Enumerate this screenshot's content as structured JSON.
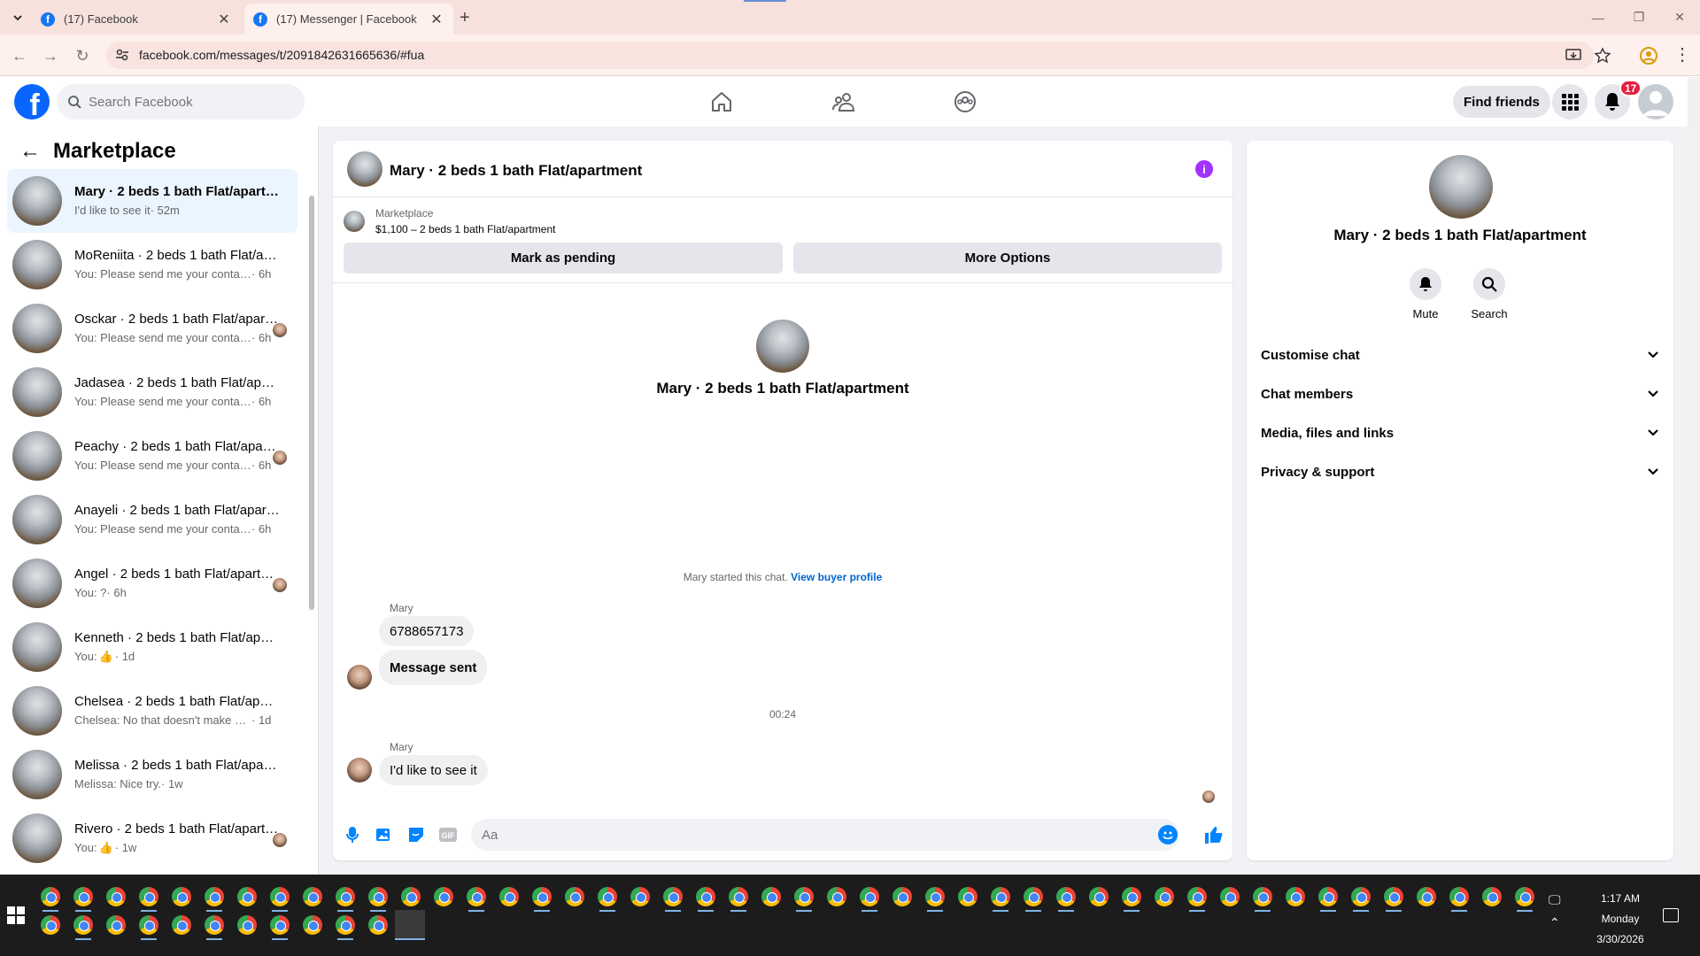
{
  "browser": {
    "tabs": [
      {
        "title": "(17) Facebook"
      },
      {
        "title": "(17) Messenger | Facebook"
      }
    ],
    "url": "facebook.com/messages/t/2091842631665636/#fua"
  },
  "header": {
    "search_placeholder": "Search Facebook",
    "find_friends": "Find friends",
    "notification_count": "17"
  },
  "sidebar": {
    "title": "Marketplace",
    "conversations": [
      {
        "name": "Mary · 2 beds 1 bath Flat/apartment",
        "preview": "I'd like to see it",
        "time": "· 52m"
      },
      {
        "name": "MoReniita · 2 beds 1 bath Flat/apartment",
        "preview": "You: Please send me your contact n...",
        "time": "· 6h"
      },
      {
        "name": "Osckar · 2 beds 1 bath Flat/apartment",
        "preview": "You: Please send me your contac...",
        "time": "· 6h"
      },
      {
        "name": "Jadasea · 2 beds 1 bath Flat/apartment",
        "preview": "You: Please send me your contact n...",
        "time": "· 6h"
      },
      {
        "name": "Peachy · 2 beds 1 bath Flat/apartment",
        "preview": "You: Please send me your contac...",
        "time": "· 6h"
      },
      {
        "name": "Anayeli · 2 beds 1 bath Flat/apartment",
        "preview": "You: Please send me your contact n...",
        "time": "· 6h"
      },
      {
        "name": "Angel · 2 beds 1 bath Flat/apartment",
        "preview": "You: ?",
        "time": "· 6h"
      },
      {
        "name": "Kenneth · 2 beds 1 bath Flat/apartment",
        "preview": "You: ",
        "time": "· 1d"
      },
      {
        "name": "Chelsea · 2 beds 1 bath Flat/apartment",
        "preview": "Chelsea: No that doesn't make sens...",
        "time": "· 1d"
      },
      {
        "name": "Melissa · 2 beds 1 bath Flat/apartment",
        "preview": "Melissa: Nice try.",
        "time": "· 1w"
      },
      {
        "name": "Rivero · 2 beds 1 bath Flat/apartment",
        "preview": "You: ",
        "time": "· 1w"
      }
    ]
  },
  "chat": {
    "title": "Mary · 2 beds 1 bath Flat/apartment",
    "listing_label": "Marketplace",
    "listing_price": "$1,100 – 2 beds 1 bath Flat/apartment",
    "mark_pending": "Mark as pending",
    "more_options": "More Options",
    "intro_name": "Mary · 2 beds 1 bath Flat/apartment",
    "started_text": "Mary started this chat.",
    "view_profile": "View buyer profile",
    "sender1": "Mary",
    "msg1": "6788657173",
    "msg2": "Message sent",
    "timestamp": "00:24",
    "sender2": "Mary",
    "msg3": "I'd like to see it",
    "input_placeholder": "Aa"
  },
  "info": {
    "name": "Mary · 2 beds 1 bath Flat/apartment",
    "mute": "Mute",
    "search": "Search",
    "sections": [
      "Customise chat",
      "Chat members",
      "Media, files and links",
      "Privacy & support"
    ]
  },
  "taskbar": {
    "time": "1:17 AM",
    "day": "Monday",
    "date": "3/30/2026"
  },
  "colors": {
    "brand": "#0866ff",
    "badge": "#e41e3f",
    "selected": "#ebf5ff"
  }
}
